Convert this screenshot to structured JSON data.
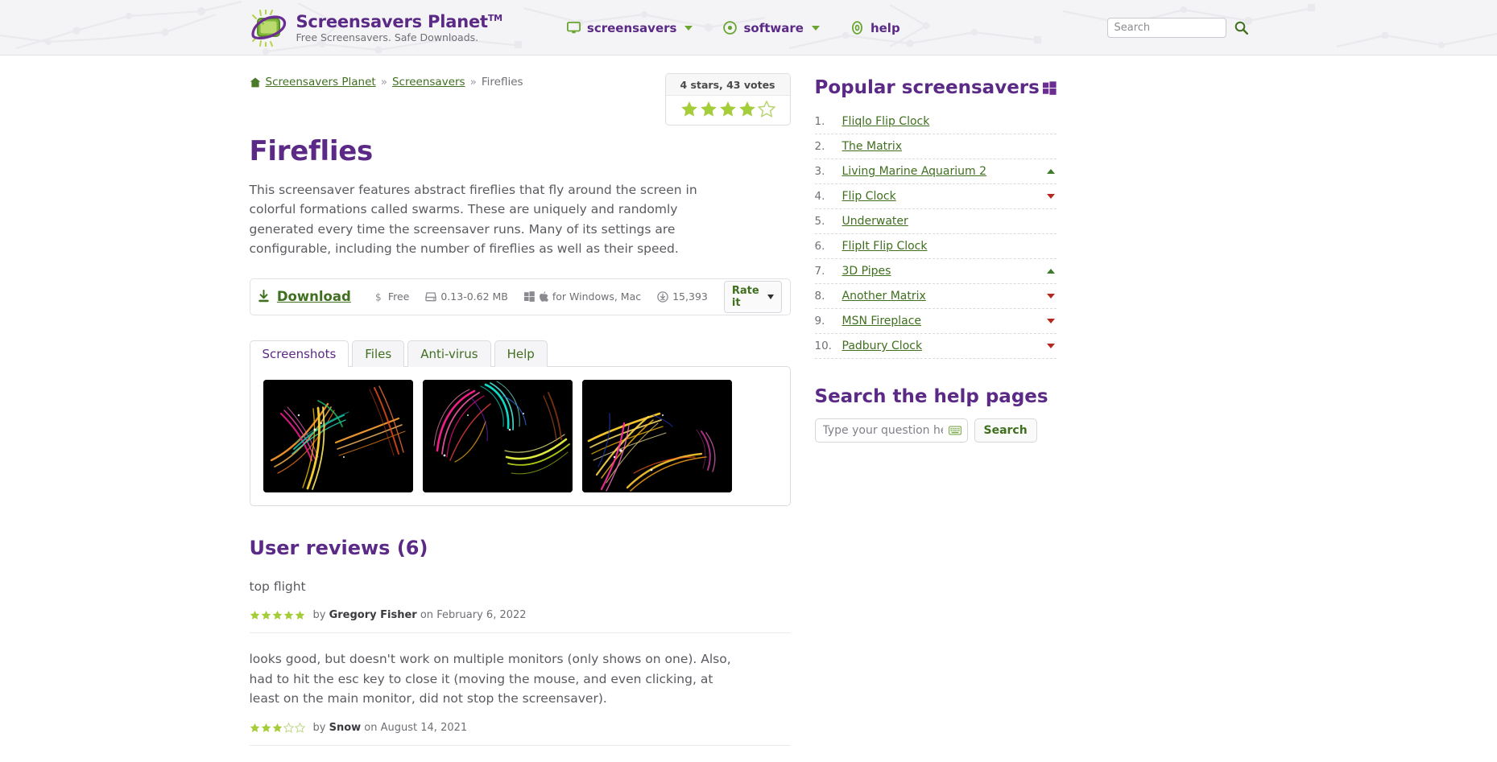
{
  "header": {
    "brand_name": "Screensavers Planet",
    "brand_tm": "TM",
    "brand_tagline": "Free Screensavers. Safe Downloads.",
    "logo_icon": "planet-screen-logo",
    "nav": [
      {
        "label": "screensavers",
        "icon": "monitor-icon",
        "has_caret": true
      },
      {
        "label": "software",
        "icon": "disc-icon",
        "has_caret": true
      },
      {
        "label": "help",
        "icon": "lifebuoy-icon",
        "has_caret": false
      }
    ],
    "search": {
      "placeholder": "Search",
      "value": "",
      "button_icon": "search-icon"
    }
  },
  "breadcrumb": {
    "home_icon": "home-icon",
    "items": [
      {
        "label": "Screensavers Planet",
        "link": true
      },
      {
        "label": "Screensavers",
        "link": true
      },
      {
        "label": "Fireflies",
        "link": false
      }
    ],
    "separator": "»"
  },
  "rating": {
    "summary": "4 stars, 43 votes",
    "filled": 4,
    "total": 5,
    "star_color": "#a5cd39",
    "star_empty_color": "#c9dd8a"
  },
  "main": {
    "title": "Fireflies",
    "description": "This screensaver features abstract fireflies that fly around the screen in colorful formations called swarms. These are uniquely and randomly generated every time the screensaver runs. Many of its settings are configurable, including the number of fireflies as well as their speed.",
    "download_bar": {
      "download_icon": "download-icon",
      "download_label": "Download",
      "price_icon": "dollar-icon",
      "price": "Free",
      "size_icon": "drive-icon",
      "size": "0.13-0.62 MB",
      "platform_icons": [
        "windows-icon",
        "apple-icon"
      ],
      "platform": "for Windows, Mac",
      "downloads_icon": "download-count-icon",
      "downloads": "15,393",
      "rate_label": "Rate it"
    },
    "tabs": [
      {
        "label": "Screenshots",
        "active": true
      },
      {
        "label": "Files",
        "active": false
      },
      {
        "label": "Anti-virus",
        "active": false
      },
      {
        "label": "Help",
        "active": false
      }
    ],
    "screenshots": [
      {
        "name": "fireflies-screenshot-1"
      },
      {
        "name": "fireflies-screenshot-2"
      },
      {
        "name": "fireflies-screenshot-3"
      }
    ],
    "reviews_title": "User reviews (6)",
    "reviews": [
      {
        "text": "top flight",
        "stars": 5,
        "by_prefix": "by",
        "author": "Gregory Fisher",
        "on_prefix": "on",
        "date": "February 6, 2022"
      },
      {
        "text": "looks good, but doesn't work on multiple monitors (only shows on one). Also, had to hit the esc key to close it (moving the mouse, and even clicking, at least on the main monitor, did not stop the screensaver).",
        "stars": 3,
        "by_prefix": "by",
        "author": "Snow",
        "on_prefix": "on",
        "date": "August 14, 2021"
      }
    ]
  },
  "sidebar": {
    "popular_title": "Popular screensavers",
    "popular_icon": "windows-icon",
    "popular_items": [
      {
        "rank": "1.",
        "label": "Fliqlo Flip Clock",
        "trend": "none"
      },
      {
        "rank": "2.",
        "label": "The Matrix",
        "trend": "none"
      },
      {
        "rank": "3.",
        "label": "Living Marine Aquarium 2",
        "trend": "up"
      },
      {
        "rank": "4.",
        "label": "Flip Clock",
        "trend": "down"
      },
      {
        "rank": "5.",
        "label": "Underwater",
        "trend": "none"
      },
      {
        "rank": "6.",
        "label": "FlipIt Flip Clock",
        "trend": "none"
      },
      {
        "rank": "7.",
        "label": "3D Pipes",
        "trend": "up"
      },
      {
        "rank": "8.",
        "label": "Another Matrix",
        "trend": "down"
      },
      {
        "rank": "9.",
        "label": "MSN Fireplace",
        "trend": "down"
      },
      {
        "rank": "10.",
        "label": "Padbury Clock",
        "trend": "down"
      }
    ],
    "help_title": "Search the help pages",
    "help_placeholder": "Type your question here",
    "help_value": "",
    "help_keyboard_icon": "keyboard-icon",
    "help_button": "Search"
  },
  "colors": {
    "brand_purple": "#5b2a86",
    "link_green": "#3f6f1f",
    "star_green": "#a5cd39",
    "trend_up": "#3f7a2c",
    "trend_down": "#b3291f",
    "header_bg": "#f4f4f6"
  }
}
